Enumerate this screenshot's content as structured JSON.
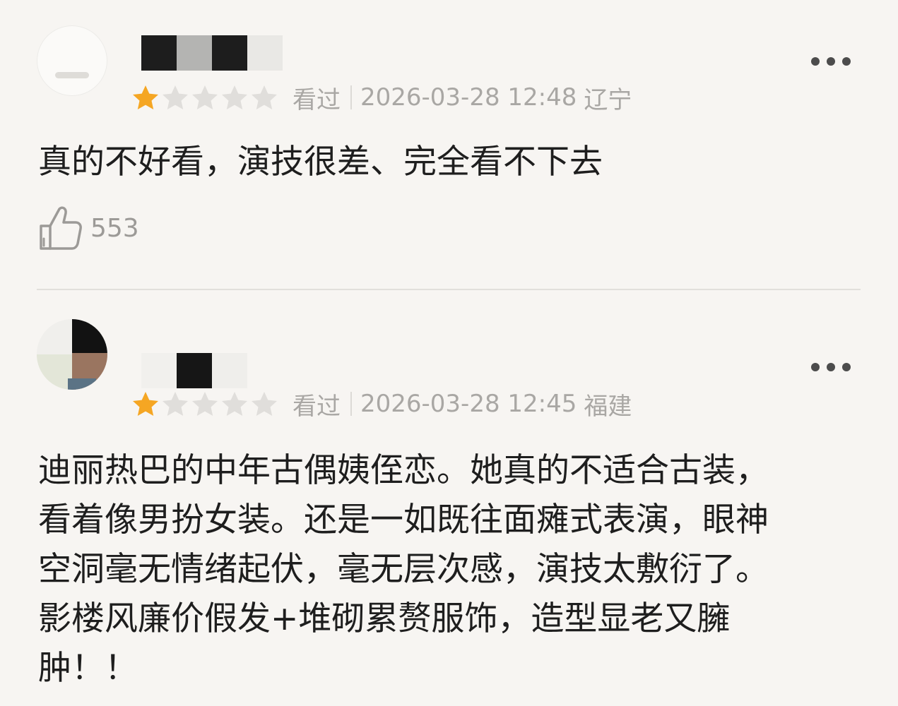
{
  "colors": {
    "background": "#f7f5f2",
    "star_filled": "#f5a623",
    "star_empty": "#e0dedb",
    "meta_text": "#a9a7a4",
    "comment_text": "#1e1e1e"
  },
  "reviews": [
    {
      "rating_stars": 1,
      "rating_max": 5,
      "watched_label": "看过",
      "date": "2026-03-28 12:48",
      "location": "辽宁",
      "comment": "真的不好看，演技很差、完全看不下去",
      "like_icon": "thumbs-up-icon",
      "likes": "553",
      "more_icon": "more-horizontal-icon"
    },
    {
      "rating_stars": 1,
      "rating_max": 5,
      "watched_label": "看过",
      "date": "2026-03-28 12:45",
      "location": "福建",
      "comment": "迪丽热巴的中年古偶姨侄恋。她真的不适合古装，\n看着像男扮女装。还是一如既往面瘫式表演，眼神\n空洞毫无情绪起伏，毫无层次感，演技太敷衍了。\n影楼风廉价假发+堆砌累赘服饰，造型显老又臃\n肿！！",
      "more_icon": "more-horizontal-icon"
    }
  ]
}
